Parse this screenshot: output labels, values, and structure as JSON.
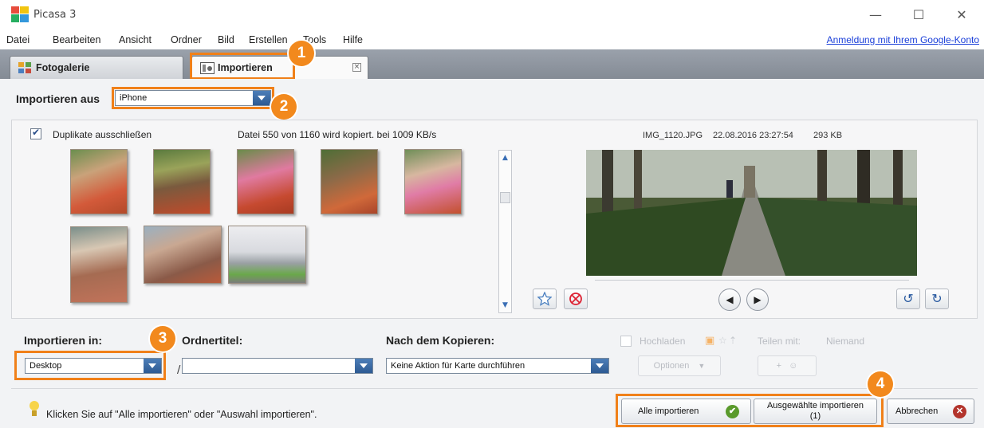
{
  "window": {
    "title": "Picasa 3",
    "controls": {
      "minimize": "—",
      "maximize": "☐",
      "close": "✕"
    }
  },
  "menu": {
    "items": [
      "Datei",
      "Bearbeiten",
      "Ansicht",
      "Ordner",
      "Bild",
      "Erstellen",
      "Tools",
      "Hilfe"
    ],
    "google_login": "Anmeldung mit Ihrem Google-Konto"
  },
  "tabs": [
    {
      "label": "Fotogalerie",
      "icon": "gallery-icon"
    },
    {
      "label": "Importieren",
      "icon": "camera-import-icon"
    }
  ],
  "import_from": {
    "label": "Importieren aus",
    "selected": "iPhone"
  },
  "options": {
    "exclude_duplicates": {
      "label": "Duplikate ausschließen",
      "checked": true
    },
    "progress": "Datei 550 von 1160 wird kopiert. bei 1009 KB/s"
  },
  "preview": {
    "filename": "IMG_1120.JPG",
    "datetime": "22.08.2016 23:27:54",
    "size": "293 KB",
    "icons": {
      "star": "star-icon",
      "reject": "reject-icon",
      "prev": "◀",
      "next": "▶",
      "rotate_left": "↺",
      "rotate_right": "↻"
    }
  },
  "import_to": {
    "label": "Importieren in:",
    "selected": "Desktop"
  },
  "folder_title": {
    "label": "Ordnertitel:",
    "value": "",
    "separator": "/"
  },
  "after_copy": {
    "label": "Nach dem Kopieren:",
    "selected": "Keine Aktion für Karte durchführen"
  },
  "upload": {
    "label": "Hochladen",
    "share_label": "Teilen mit:",
    "share_value": "Niemand",
    "options_button": "Optionen",
    "add_people_button": "+"
  },
  "hint": "Klicken Sie auf \"Alle importieren\" oder \"Auswahl importieren\".",
  "buttons": {
    "import_all": "Alle importieren",
    "import_selected_line1": "Ausgewählte importieren",
    "import_selected_line2": "(1)",
    "cancel": "Abbrechen"
  },
  "callouts": [
    "1",
    "2",
    "3",
    "4"
  ],
  "colors": {
    "accent_orange": "#f08019",
    "badge_orange": "#f2891d",
    "select_blue": "#2d5a93",
    "link_blue": "#1a3fd9"
  }
}
